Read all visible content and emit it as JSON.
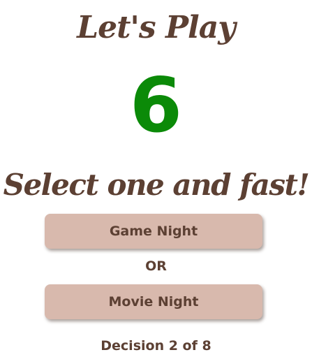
{
  "header": {
    "title": "Let's Play"
  },
  "timer": {
    "value": "6",
    "color": "#0b8a08"
  },
  "prompt": {
    "text": "Select one and fast!"
  },
  "choices": {
    "option_a": "Game Night",
    "separator": "OR",
    "option_b": "Movie Night"
  },
  "progress": {
    "text": "Decision 2 of 8",
    "current": 2,
    "total": 8
  },
  "colors": {
    "text_brown": "#5c4033",
    "button_bg": "#d8b9ad",
    "timer_green": "#0b8a08"
  }
}
